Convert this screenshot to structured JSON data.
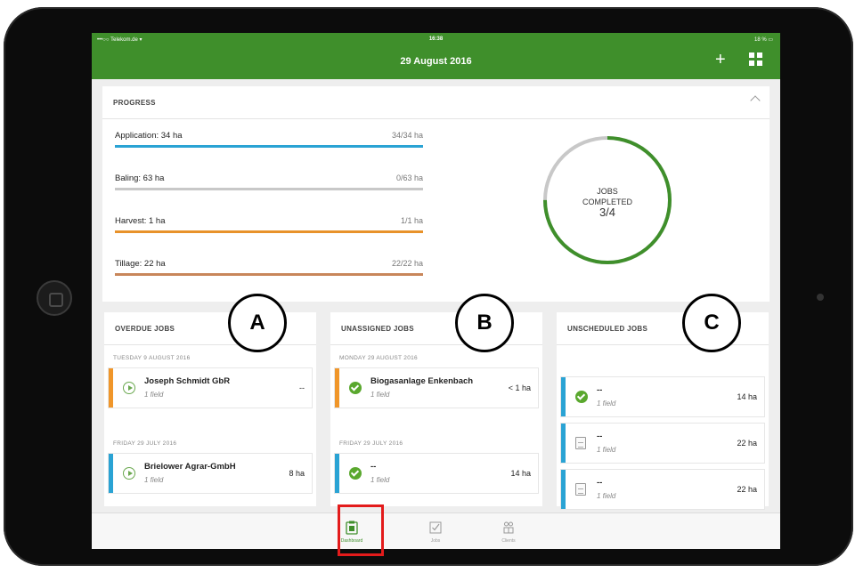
{
  "status_bar": {
    "carrier": "•••○○ Telekom.de ▾",
    "time": "16:38",
    "battery": "18 % ▭"
  },
  "header": {
    "date": "29 August 2016",
    "add_label": "+"
  },
  "progress": {
    "title": "PROGRESS",
    "items": [
      {
        "label": "Application: 34 ha",
        "value": "34/34 ha",
        "fraction": 1.0,
        "color": "#2aa3d4"
      },
      {
        "label": "Baling: 63 ha",
        "value": "0/63 ha",
        "fraction": 0.0,
        "color": "#bdbdbd"
      },
      {
        "label": "Harvest: 1 ha",
        "value": "1/1 ha",
        "fraction": 1.0,
        "color": "#e8922a"
      },
      {
        "label": "Tillage: 22 ha",
        "value": "22/22 ha",
        "fraction": 1.0,
        "color": "#c8865a"
      }
    ],
    "jobs_line1": "JOBS",
    "jobs_line2": "COMPLETED",
    "jobs_count": "3/4",
    "jobs_fraction": 0.75,
    "ring_color": "#3f8f2b",
    "ring_track": "#c8c8c8"
  },
  "overdue": {
    "title": "OVERDUE JOBS",
    "groups": [
      {
        "date": "TUESDAY 9 AUGUST 2016",
        "name": "Joseph Schmidt GbR",
        "sub": "1 field",
        "value": "--",
        "strip": "#f0962a",
        "icon": "play-icon"
      },
      {
        "date": "FRIDAY 29 JULY 2016",
        "name": "Brielower Agrar-GmbH",
        "sub": "1 field",
        "value": "8 ha",
        "strip": "#2aa3d4",
        "icon": "play-icon"
      }
    ]
  },
  "unassigned": {
    "title": "UNASSIGNED JOBS",
    "groups": [
      {
        "date": "MONDAY 29 AUGUST 2016",
        "name": "Biogasanlage Enkenbach",
        "sub": "1 field",
        "value": "< 1 ha",
        "strip": "#f0962a",
        "icon": "check-icon"
      },
      {
        "date": "FRIDAY 29 JULY 2016",
        "name": "--",
        "sub": "1 field",
        "value": "14 ha",
        "strip": "#2aa3d4",
        "icon": "check-icon"
      }
    ]
  },
  "unscheduled": {
    "title": "UNSCHEDULED JOBS",
    "cards": [
      {
        "name": "--",
        "sub": "1 field",
        "value": "14 ha",
        "strip": "#2aa3d4",
        "icon": "check-icon"
      },
      {
        "name": "--",
        "sub": "1 field",
        "value": "22 ha",
        "strip": "#2aa3d4",
        "icon": "document-icon"
      },
      {
        "name": "--",
        "sub": "1 field",
        "value": "22 ha",
        "strip": "#2aa3d4",
        "icon": "document-icon"
      }
    ]
  },
  "tabs": [
    {
      "label": "Dashboard",
      "icon": "clipboard-icon",
      "active": true
    },
    {
      "label": "Jobs",
      "icon": "checkbox-icon",
      "active": false
    },
    {
      "label": "Clients",
      "icon": "people-icon",
      "active": false
    }
  ],
  "callouts": {
    "a": "A",
    "b": "B",
    "c": "C"
  },
  "highlight_color": "#e31b1b"
}
